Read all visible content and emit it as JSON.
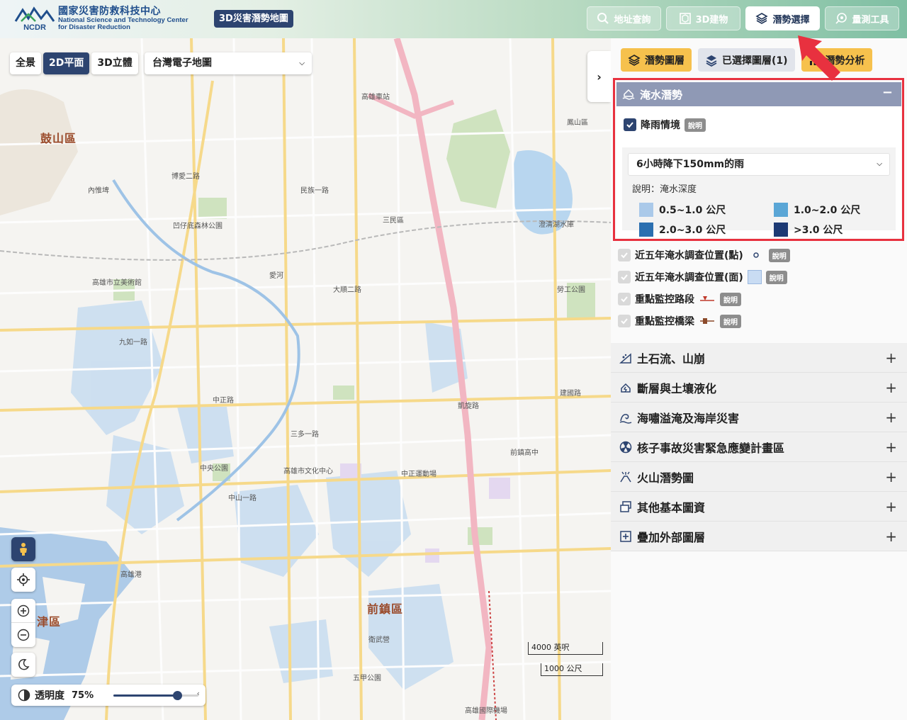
{
  "header": {
    "logo_cn": "國家災害防救科技中心",
    "logo_en_1": "National Science and Technology Center",
    "logo_en_2": "for Disaster Reduction",
    "logo_short": "NCDR",
    "app_title": "3D災害潛勢地圖",
    "nav": [
      {
        "label": "地址查詢",
        "icon": "search-icon"
      },
      {
        "label": "3D建物",
        "icon": "3d-building-icon"
      },
      {
        "label": "潛勢選擇",
        "icon": "layers-icon",
        "active": true
      },
      {
        "label": "量測工具",
        "icon": "measure-icon"
      }
    ]
  },
  "map": {
    "view_tabs": [
      "全景",
      "2D平面",
      "3D立體"
    ],
    "active_view": "2D平面",
    "basemap": "台灣電子地圖",
    "districts": [
      "鼓山區",
      "前鎮區",
      "津區"
    ],
    "labels": [
      "內惟埤",
      "凹仔底森林公園",
      "愛河",
      "高雄市立美術館",
      "高雄車站",
      "澄清湖水庫",
      "三民區",
      "中正路",
      "建國路",
      "九如一路",
      "博愛二路",
      "民族一路",
      "大順二路",
      "中山一路",
      "五甲公園",
      "衛武營",
      "高雄港",
      "勞工公園",
      "三多一路",
      "凱旋路",
      "高雄市文化中心",
      "中央公園",
      "前鎮高中",
      "中正運動場",
      "高雄國際機場",
      "鳳山區"
    ],
    "opacity_label": "透明度",
    "opacity_value": "75%",
    "opacity_fraction": 0.75,
    "scale_1": "4000 英呎",
    "scale_2": "1000 公尺"
  },
  "panel": {
    "tabs": [
      {
        "label": "潛勢圖層",
        "icon": "layers-icon"
      },
      {
        "label": "已選擇圖層(1)",
        "icon": "selected-layers-icon"
      },
      {
        "label": "潛勢分析",
        "icon": "analysis-icon"
      }
    ],
    "flood": {
      "title": "淹水潛勢",
      "rain_label": "降雨情境",
      "info": "說明",
      "scenario": "6小時降下150mm的雨",
      "desc": "說明：淹水深度",
      "legend": [
        {
          "label": "0.5~1.0 公尺",
          "color": "#aac9e9"
        },
        {
          "label": "1.0~2.0 公尺",
          "color": "#5aa6d6"
        },
        {
          "label": "2.0~3.0 公尺",
          "color": "#2b6fb0"
        },
        {
          "label": ">3.0 公尺",
          "color": "#1d3a74"
        }
      ],
      "layers": [
        {
          "label": "近五年淹水調查位置(點)",
          "info": "說明"
        },
        {
          "label": "近五年淹水調查位置(面)",
          "info": "說明"
        },
        {
          "label": "重點監控路段",
          "info": "說明"
        },
        {
          "label": "重點監控橋梁",
          "info": "說明"
        }
      ]
    },
    "categories": [
      {
        "label": "土石流、山崩",
        "icon": "landslide-icon"
      },
      {
        "label": "斷層與土壤液化",
        "icon": "fault-icon"
      },
      {
        "label": "海嘯溢淹及海岸災害",
        "icon": "tsunami-icon"
      },
      {
        "label": "核子事故災害緊急應變計畫區",
        "icon": "nuclear-icon"
      },
      {
        "label": "火山潛勢圖",
        "icon": "volcano-icon"
      },
      {
        "label": "其他基本圖資",
        "icon": "base-map-icon"
      },
      {
        "label": "疊加外部圖層",
        "icon": "add-layer-icon"
      }
    ]
  }
}
